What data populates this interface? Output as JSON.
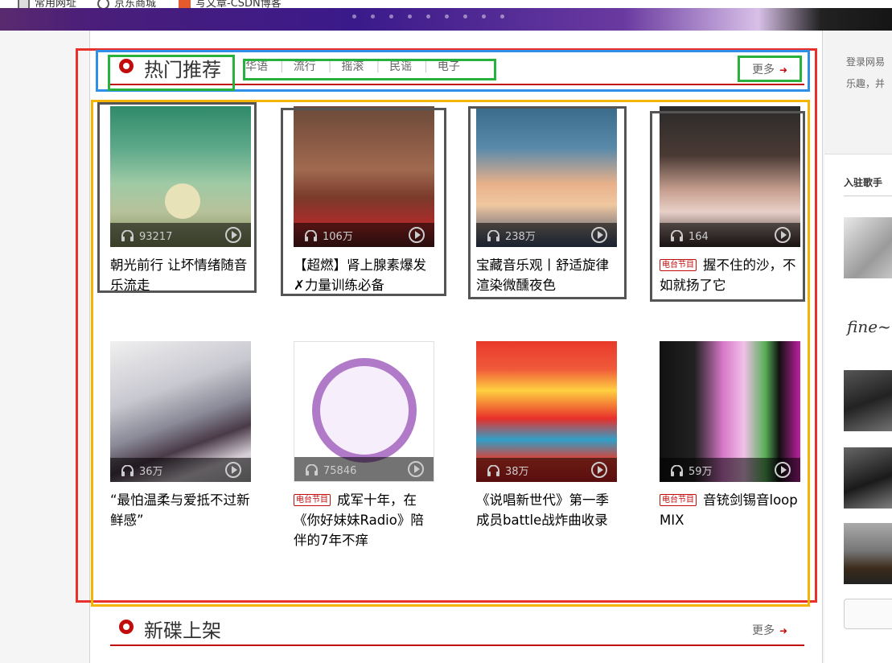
{
  "bookmarks": [
    {
      "label": "常用网址",
      "icon": "folder-icon"
    },
    {
      "label": "京东商城",
      "icon": "globe-icon"
    },
    {
      "label": "写文章-CSDN博客",
      "icon": "csdn-icon"
    }
  ],
  "hot": {
    "title": "热门推荐",
    "tabs": [
      "华语",
      "流行",
      "摇滚",
      "民谣",
      "电子"
    ],
    "more": "更多"
  },
  "playlists": [
    {
      "name": "朝光前行 让坏情绪随音乐流走",
      "plays": "93217",
      "badge": ""
    },
    {
      "name": "【超燃】肾上腺素爆发✗力量训练必备",
      "plays": "106万",
      "badge": ""
    },
    {
      "name": "宝藏音乐观丨舒适旋律渲染微醺夜色",
      "plays": "238万",
      "badge": ""
    },
    {
      "name": "握不住的沙，不如就扬了它",
      "plays": "164",
      "badge": "电台节目"
    },
    {
      "name": "“最怕温柔与爱抵不过新鲜感”",
      "plays": "36万",
      "badge": ""
    },
    {
      "name": "成军十年，在《你好妹妹Radio》陪伴的7年不痒",
      "plays": "75846",
      "badge": "电台节目"
    },
    {
      "name": "《说唱新世代》第一季成员battle战炸曲收录",
      "plays": "38万",
      "badge": ""
    },
    {
      "name": "音铳剑锡音loop MIX",
      "plays": "59万",
      "badge": "电台节目"
    }
  ],
  "new_albums": {
    "title": "新碟上架",
    "more": "更多"
  },
  "sidebar": {
    "login_line1": "登录网易",
    "login_line2": "乐趣，并",
    "singers_title": "入驻歌手"
  },
  "colors": {
    "accent": "#c20c0c",
    "annotation_red": "#e8312a",
    "annotation_blue": "#2f8fe8",
    "annotation_green": "#28b23c",
    "annotation_orange": "#f5b400",
    "annotation_dark": "#555555"
  }
}
